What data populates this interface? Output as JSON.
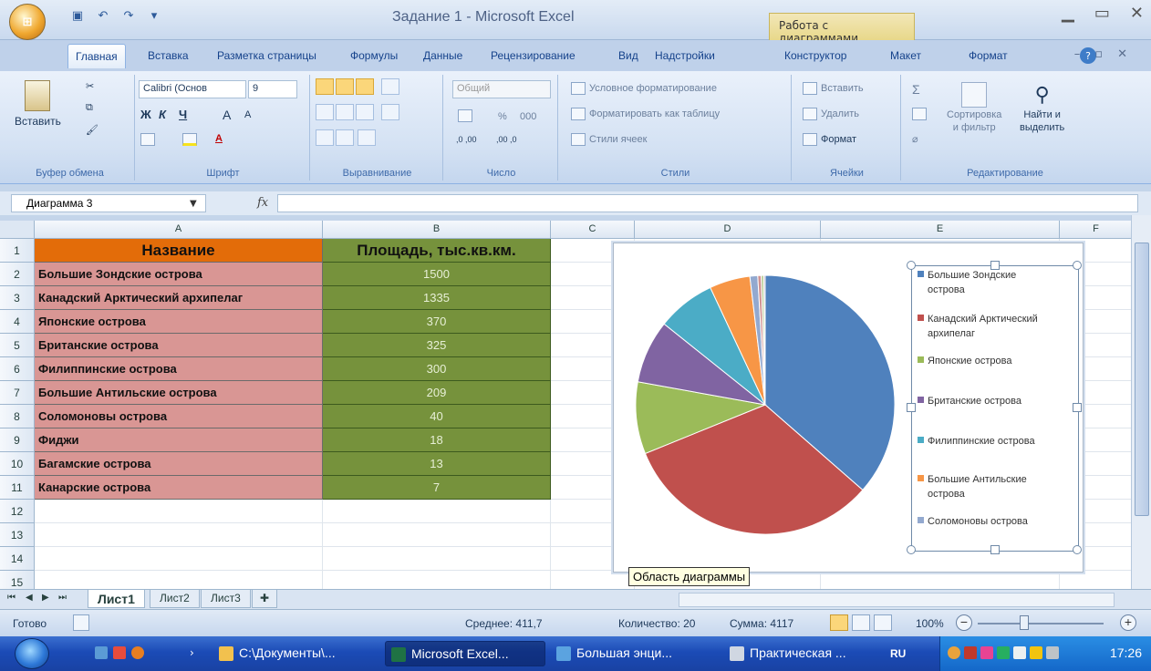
{
  "window": {
    "title": "Задание 1 - Microsoft Excel",
    "context_tab_title": "Работа с диаграммами",
    "office_button": "",
    "controls": [
      "minimize-icon",
      "maximize-icon",
      "close-icon"
    ]
  },
  "tabs": [
    {
      "label": "Главная",
      "active": true
    },
    {
      "label": "Вставка"
    },
    {
      "label": "Разметка страницы"
    },
    {
      "label": "Формулы"
    },
    {
      "label": "Данные"
    },
    {
      "label": "Рецензирование"
    },
    {
      "label": "Вид"
    },
    {
      "label": "Надстройки"
    },
    {
      "label": "Конструктор"
    },
    {
      "label": "Макет"
    },
    {
      "label": "Формат"
    }
  ],
  "ribbon": {
    "clipboard": {
      "label": "Буфер обмена",
      "paste": "Вставить"
    },
    "font": {
      "label": "Шрифт",
      "font_name": "Calibri (Основ",
      "font_size": "9",
      "bold": "Ж",
      "italic": "К",
      "underline": "Ч",
      "grow": "A",
      "shrink": "A",
      "font_color": "A"
    },
    "alignment": {
      "label": "Выравнивание"
    },
    "number": {
      "label": "Число",
      "format": "Общий",
      "percent": "%",
      "thousands": "000",
      "inc_decimal": ",0 ,00",
      "dec_decimal": ",00 ,0"
    },
    "styles": {
      "label": "Стили",
      "conditional": "Условное форматирование",
      "as_table": "Форматировать как таблицу",
      "cell_styles": "Стили ячеек"
    },
    "cells": {
      "label": "Ячейки",
      "insert": "Вставить",
      "delete": "Удалить",
      "format": "Формат"
    },
    "editing": {
      "label": "Редактирование",
      "sort1": "Сортировка",
      "sort2": "и фильтр",
      "find1": "Найти и",
      "find2": "выделить",
      "sigma": "Σ"
    }
  },
  "formula_bar": {
    "name_box": "Диаграмма 3",
    "fx": "fx",
    "value": ""
  },
  "columns": [
    "A",
    "B",
    "C",
    "D",
    "E",
    "F"
  ],
  "rows": [
    "1",
    "2",
    "3",
    "4",
    "5",
    "6",
    "7",
    "8",
    "9",
    "10",
    "11",
    "12",
    "13",
    "14",
    "15"
  ],
  "table": {
    "header": [
      "Название",
      "Площадь, тыс.кв.км."
    ],
    "rows": [
      [
        "Большие Зондские острова",
        "1500"
      ],
      [
        "Канадский Арктический архипелаг",
        "1335"
      ],
      [
        "Японские острова",
        "370"
      ],
      [
        "Британские острова",
        "325"
      ],
      [
        "Филиппинские острова",
        "300"
      ],
      [
        "Большие Антильские острова",
        "209"
      ],
      [
        "Соломоновы острова",
        "40"
      ],
      [
        "Фиджи",
        "18"
      ],
      [
        "Багамские острова",
        "13"
      ],
      [
        "Канарские острова",
        "7"
      ]
    ]
  },
  "chart_data": {
    "type": "pie",
    "categories": [
      "Большие Зондские острова",
      "Канадский Арктический архипелаг",
      "Японские острова",
      "Британские острова",
      "Филиппинские острова",
      "Большие Антильские острова",
      "Соломоновы острова",
      "Фиджи",
      "Багамские острова",
      "Канарские острова"
    ],
    "values": [
      1500,
      1335,
      370,
      325,
      300,
      209,
      40,
      18,
      13,
      7
    ],
    "colors": [
      "#4f81bd",
      "#c0504d",
      "#9bbb59",
      "#8064a2",
      "#4bacc6",
      "#f79646",
      "#93a9cf",
      "#d19392",
      "#b9cd96",
      "#a99bbd"
    ],
    "legend_visible": [
      "Большие Зондские острова",
      "Канадский Арктический архипелаг",
      "Японские острова",
      "Британские острова",
      "Филиппинские острова",
      "Большие Антильские острова",
      "Соломоновы острова"
    ],
    "legend_lines": [
      [
        "Большие Зондские",
        "острова"
      ],
      [
        "Канадский Арктический",
        "архипелаг"
      ],
      [
        "Японские острова"
      ],
      [
        "Британские острова"
      ],
      [
        "Филиппинские острова"
      ],
      [
        "Большие Антильские",
        "острова"
      ],
      [
        "Соломоновы острова"
      ]
    ],
    "legend_position": "right",
    "title": ""
  },
  "tooltip": "Область диаграммы",
  "sheets": [
    {
      "label": "Лист1",
      "active": true
    },
    {
      "label": "Лист2"
    },
    {
      "label": "Лист3"
    }
  ],
  "status": {
    "ready": "Готово",
    "average": "Среднее: 411,7",
    "count": "Количество: 20",
    "sum": "Сумма: 4117",
    "zoom": "100%"
  },
  "taskbar": {
    "items": [
      "C:\\Документы\\...",
      "Microsoft Excel...",
      "Большая энци...",
      "Практическая ..."
    ],
    "lang": "RU",
    "clock": "17:26"
  }
}
